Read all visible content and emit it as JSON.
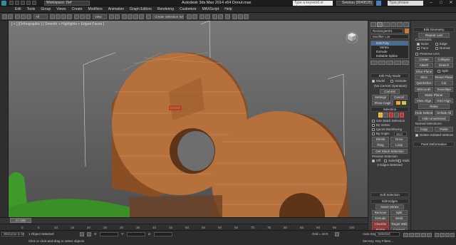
{
  "titlebar": {
    "workspace": "Workspace: Def",
    "app_title": "Autodesk 3ds Max  2014 x64     Donut.max",
    "search_placeholder": "Type a keyword or phrase",
    "user": "Sewouu (8049535)",
    "help_placeholder": "Type phrase",
    "min": "–",
    "max": "□",
    "close": "✕"
  },
  "menu": {
    "items": [
      "Edit",
      "Tools",
      "Group",
      "Views",
      "Create",
      "Modifiers",
      "Animation",
      "Graph Editors",
      "Rendering",
      "Customize",
      "MAXScript",
      "Help"
    ]
  },
  "toolbar": {
    "selection_set": "All",
    "view_dropdown": "View",
    "named_sel": "Create Selection Se"
  },
  "viewport": {
    "label": "[ + ] [Orthographic ] [ Smooth + Highlights + Edged Faces ]"
  },
  "command_panel": {
    "object_name": "Rectangle001",
    "modifier_list": "Modifier List",
    "stack": [
      "Edit Poly",
      "Vertex",
      "Extrude",
      "Editable Spline"
    ],
    "stack_selected_index": 0,
    "edit_poly_mode": {
      "title": "Edit Poly Mode",
      "model": "Model",
      "animate": "Animate",
      "no_current_op": "(No Current Operation)",
      "commit": "Commit",
      "settings": "Settings",
      "cancel": "Cancel",
      "show_cage": "Show Cage"
    },
    "selection": {
      "title": "Selection",
      "use_stack_selection": "Use Stack Selection",
      "by_vertex": "By Vertex",
      "ignore_backfacing": "Ignore Backfacing",
      "by_angle": "By Angle:",
      "angle_value": "45.0",
      "shrink": "Shrink",
      "grow": "Grow",
      "ring": "Ring",
      "loop": "Loop",
      "get_stack_selection": "Get Stack Selection",
      "preview_selection": "Preview Selection",
      "off": "Off",
      "subobj": "SubObj",
      "multi": "Multi",
      "selected_count": "0 Edges Selected"
    },
    "soft_selection": {
      "title": "Soft Selection"
    },
    "edit_edges": {
      "title": "Edit Edges",
      "insert_vertex": "Insert Vertex",
      "remove": "Remove",
      "split": "Split",
      "extrude": "Extrude",
      "weld": "Weld",
      "chamfer": "Chamfer",
      "target_weld": "Target Weld",
      "bridge": "Bridge",
      "connect": "Connect",
      "create_shape": "Create Shape",
      "edit_tri": "Edit Tri.",
      "turn": "Turn"
    }
  },
  "right_panel": {
    "edit_geometry": "Edit Geometry",
    "repeat_last": "Repeat Last",
    "constraints": "Constraints",
    "none": "None",
    "edge": "Edge",
    "face": "Face",
    "normal": "Normal",
    "preserve_uvs": "Preserve UVs",
    "create": "Create",
    "collapse": "Collapse",
    "attach": "Attach",
    "detach": "Detach",
    "slice_plane": "Slice Plane",
    "split": "Split",
    "slice": "Slice",
    "reset_plane": "Reset Plane",
    "quickslice": "QuickSlice",
    "cut": "Cut",
    "msmooth": "MSmooth",
    "tessellate": "Tessellate",
    "make_planar": "Make Planar",
    "view_align": "View Align",
    "grid_align": "Grid Align",
    "relax": "Relax",
    "hide_selected": "Hide Selected",
    "unhide_all": "Unhide All",
    "hide_unselected": "Hide Unselected",
    "named_selections": "Named Selections:",
    "copy": "Copy",
    "paste": "Paste",
    "delete_isolated": "Delete Isolated Vertices",
    "paint_deformation": "Paint Deformation"
  },
  "timeline": {
    "frame": "0 / 100",
    "ticks": [
      "0",
      "5",
      "10",
      "15",
      "20",
      "25",
      "30",
      "35",
      "40",
      "45",
      "50",
      "55",
      "60",
      "65",
      "70",
      "75",
      "80",
      "85",
      "90",
      "95",
      "100"
    ]
  },
  "status": {
    "script_label": "Welcome to M",
    "objects_selected": "1 Object Selected",
    "prompt": "Click or click-and-drag to select objects",
    "x_label": "X:",
    "y_label": "Y:",
    "z_label": "Z:",
    "grid": "Grid = 10.0",
    "auto_key": "Auto Key",
    "selected": "Selected",
    "set_key": "Set Key",
    "key_filters": "Key Filters..."
  },
  "colors": {
    "wood": "#b5703c",
    "wood_dark": "#7a4520",
    "grass": "#3f9a2a",
    "selection_red": "#cc2222",
    "accent_blue": "#4a6d94"
  }
}
